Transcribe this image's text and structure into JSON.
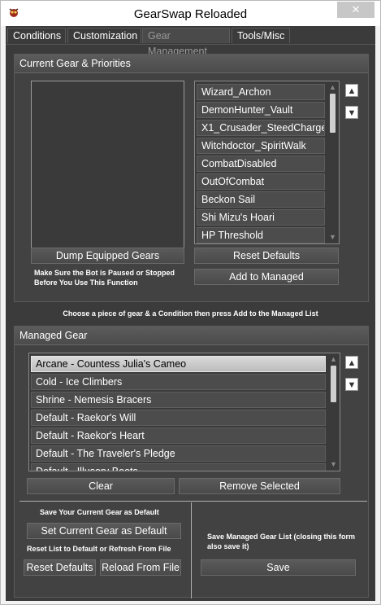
{
  "window": {
    "title": "GearSwap Reloaded",
    "close_glyph": "✕"
  },
  "tabs": [
    {
      "label": "Conditions"
    },
    {
      "label": "Customization"
    },
    {
      "label": "Gear Management"
    },
    {
      "label": "Tools/Misc"
    }
  ],
  "current_gear": {
    "header": "Current Gear & Priorities",
    "conditions": [
      "Wizard_Archon",
      "DemonHunter_Vault",
      "X1_Crusader_SteedCharge",
      "Witchdoctor_SpiritWalk",
      "CombatDisabled",
      "OutOfCombat",
      "Beckon Sail",
      "Shi Mizu's Hoari",
      "HP Threshold"
    ],
    "dump_button": "Dump Equipped Gears",
    "warning_note": "Make Sure the Bot is Paused or Stopped Before You Use This Function",
    "reset_defaults_button": "Reset Defaults",
    "add_to_managed_button": "Add to Managed"
  },
  "instruction": "Choose a piece of gear & a Condition then press Add to the Managed List",
  "managed_gear": {
    "header": "Managed Gear",
    "items": [
      "Arcane - Countess Julia's Cameo",
      "Cold - Ice Climbers",
      "Shrine - Nemesis Bracers",
      "Default - Raekor's Will",
      "Default - Raekor's Heart",
      "Default - The Traveler's Pledge",
      "Default - Illusory Boots"
    ],
    "clear_button": "Clear",
    "remove_selected_button": "Remove Selected",
    "save_default_note": "Save Your Current Gear as Default",
    "set_default_button": "Set Current Gear as Default",
    "reset_list_note": "Reset List to Default or Refresh From File",
    "reset_defaults_button": "Reset Defaults",
    "reload_button": "Reload From File",
    "save_list_note": "Save Managed Gear List (closing this form also save it)",
    "save_button": "Save"
  },
  "icons": {
    "up_arrow": "▲",
    "down_arrow": "▼"
  },
  "colors": {
    "panel": "#424242",
    "selected_item": "#d0d0d0",
    "background": "#3b3b3b"
  }
}
